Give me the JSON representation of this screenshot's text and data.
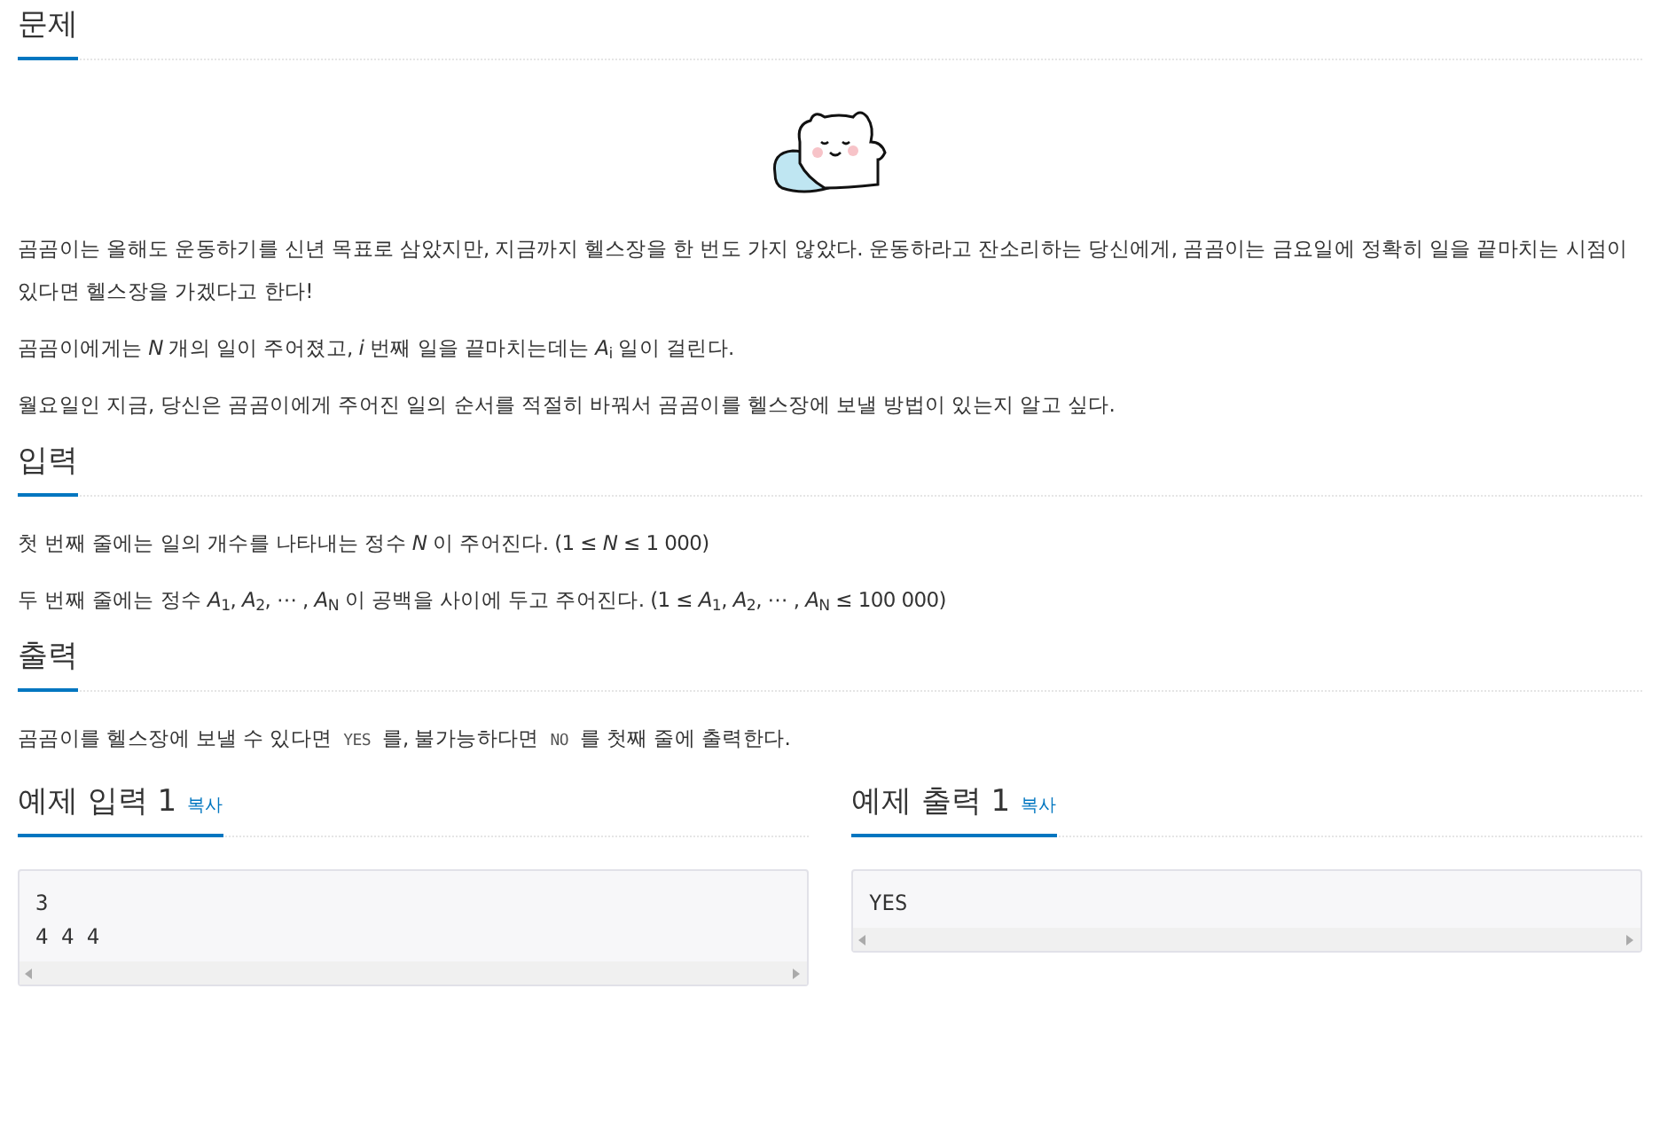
{
  "sections": [
    {
      "heading": "문제",
      "illustration": true,
      "paragraphs": [
        [
          {
            "kind": "text",
            "text": "곰곰이는 올해도 운동하기를 신년 목표로 삼았지만, 지금까지 헬스장을 한 번도 가지 않았다. 운동하라고 잔소리하는 당신에게, 곰곰이는 금요일에 정확히 일을 끝마치는 시점이 있다면 헬스장을 가겠다고 한다!"
          }
        ],
        [
          {
            "kind": "text",
            "text": "곰곰이에게는 *N* 개의 일이 주어졌고, *i* 번째 일을 끝마치는데는 *A*$_{i}$ 일이 걸린다."
          }
        ],
        [
          {
            "kind": "text",
            "text": "월요일인 지금, 당신은 곰곰이에게 주어진 일의 순서를 적절히 바꿔서 곰곰이를 헬스장에 보낼 방법이 있는지 알고 싶다."
          }
        ]
      ]
    },
    {
      "heading": "입력",
      "illustration": false,
      "paragraphs": [
        [
          {
            "kind": "text",
            "text": "첫 번째 줄에는 일의 개수를 나타내는 정수 *N* 이 주어진다. (1 ≤ *N* ≤ 1 000)"
          }
        ],
        [
          {
            "kind": "text",
            "text": "두 번째 줄에는 정수 *A*$_{1}$, *A*$_{2}$, ⋯ , *A*$_{N}$ 이 공백을 사이에 두고 주어진다. (1 ≤ *A*$_{1}$, *A*$_{2}$, ⋯ , *A*$_{N}$ ≤ 100 000)"
          }
        ]
      ]
    },
    {
      "heading": "출력",
      "illustration": false,
      "paragraphs": [
        [
          {
            "kind": "text",
            "text": "곰곰이를 헬스장에 보낼 수 있다면 "
          },
          {
            "kind": "code",
            "text": "YES"
          },
          {
            "kind": "text",
            "text": " 를, 불가능하다면 "
          },
          {
            "kind": "code",
            "text": "NO"
          },
          {
            "kind": "text",
            "text": " 를 첫째 줄에 출력한다."
          }
        ]
      ]
    }
  ],
  "samples": [
    {
      "heading": "예제 입력 1",
      "copy": "복사",
      "lines": [
        "3",
        "4 4 4"
      ]
    },
    {
      "heading": "예제 출력 1",
      "copy": "복사",
      "lines": [
        "YES"
      ]
    }
  ]
}
